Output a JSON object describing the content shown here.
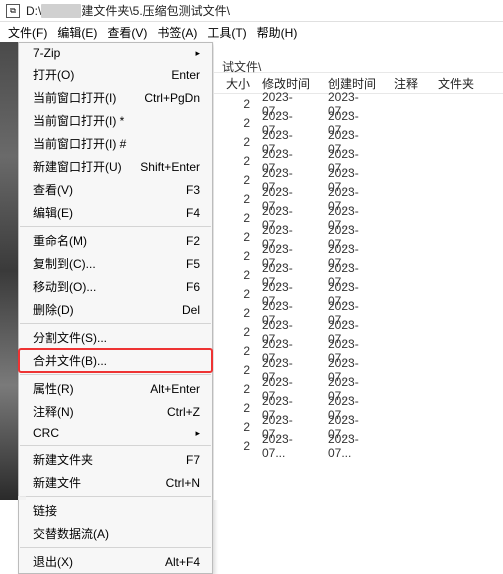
{
  "title": {
    "prefix": "D:\\",
    "suffix": "建文件夹\\5.压缩包测试文件\\"
  },
  "menubar": [
    "文件(F)",
    "编辑(E)",
    "查看(V)",
    "书签(A)",
    "工具(T)",
    "帮助(H)"
  ],
  "dropdown": [
    {
      "type": "item",
      "label": "7-Zip",
      "arrow": true
    },
    {
      "type": "item",
      "label": "打开(O)",
      "shortcut": "Enter"
    },
    {
      "type": "item",
      "label": "当前窗口打开(I)",
      "shortcut": "Ctrl+PgDn"
    },
    {
      "type": "item",
      "label": "当前窗口打开(I) *"
    },
    {
      "type": "item",
      "label": "当前窗口打开(I) #"
    },
    {
      "type": "item",
      "label": "新建窗口打开(U)",
      "shortcut": "Shift+Enter"
    },
    {
      "type": "item",
      "label": "查看(V)",
      "shortcut": "F3"
    },
    {
      "type": "item",
      "label": "编辑(E)",
      "shortcut": "F4"
    },
    {
      "type": "sep"
    },
    {
      "type": "item",
      "label": "重命名(M)",
      "shortcut": "F2"
    },
    {
      "type": "item",
      "label": "复制到(C)...",
      "shortcut": "F5"
    },
    {
      "type": "item",
      "label": "移动到(O)...",
      "shortcut": "F6"
    },
    {
      "type": "item",
      "label": "删除(D)",
      "shortcut": "Del"
    },
    {
      "type": "sep"
    },
    {
      "type": "item",
      "label": "分割文件(S)..."
    },
    {
      "type": "item",
      "label": "合并文件(B)...",
      "highlight": true
    },
    {
      "type": "sep"
    },
    {
      "type": "item",
      "label": "属性(R)",
      "shortcut": "Alt+Enter"
    },
    {
      "type": "item",
      "label": "注释(N)",
      "shortcut": "Ctrl+Z"
    },
    {
      "type": "item",
      "label": "CRC",
      "arrow": true
    },
    {
      "type": "sep"
    },
    {
      "type": "item",
      "label": "新建文件夹",
      "shortcut": "F7"
    },
    {
      "type": "item",
      "label": "新建文件",
      "shortcut": "Ctrl+N"
    },
    {
      "type": "sep"
    },
    {
      "type": "item",
      "label": "链接"
    },
    {
      "type": "item",
      "label": "交替数据流(A)"
    },
    {
      "type": "sep"
    },
    {
      "type": "item",
      "label": "退出(X)",
      "shortcut": "Alt+F4"
    }
  ],
  "footer_path": "",
  "address_suffix": "试文件\\",
  "columns": {
    "size": "大小",
    "mod": "修改时间",
    "cre": "创建时间",
    "note": "注释",
    "folder": "文件夹"
  },
  "rows": [
    {
      "size": "2",
      "mod": "2023-07...",
      "cre": "2023-07..."
    },
    {
      "size": "2",
      "mod": "2023-07...",
      "cre": "2023-07..."
    },
    {
      "size": "2",
      "mod": "2023-07...",
      "cre": "2023-07..."
    },
    {
      "size": "2",
      "mod": "2023-07...",
      "cre": "2023-07..."
    },
    {
      "size": "2",
      "mod": "2023-07...",
      "cre": "2023-07..."
    },
    {
      "size": "2",
      "mod": "2023-07...",
      "cre": "2023-07..."
    },
    {
      "size": "2",
      "mod": "2023-07...",
      "cre": "2023-07..."
    },
    {
      "size": "2",
      "mod": "2023-07...",
      "cre": "2023-07..."
    },
    {
      "size": "2",
      "mod": "2023-07...",
      "cre": "2023-07..."
    },
    {
      "size": "2",
      "mod": "2023-07...",
      "cre": "2023-07..."
    },
    {
      "size": "2",
      "mod": "2023-07...",
      "cre": "2023-07..."
    },
    {
      "size": "2",
      "mod": "2023-07...",
      "cre": "2023-07..."
    },
    {
      "size": "2",
      "mod": "2023-07...",
      "cre": "2023-07..."
    },
    {
      "size": "2",
      "mod": "2023-07...",
      "cre": "2023-07..."
    },
    {
      "size": "2",
      "mod": "2023-07...",
      "cre": "2023-07..."
    },
    {
      "size": "2",
      "mod": "2023-07...",
      "cre": "2023-07..."
    },
    {
      "size": "2",
      "mod": "2023-07...",
      "cre": "2023-07..."
    },
    {
      "size": "2",
      "mod": "2023-07...",
      "cre": "2023-07..."
    },
    {
      "size": "2",
      "mod": "2023-07...",
      "cre": "2023-07..."
    }
  ]
}
